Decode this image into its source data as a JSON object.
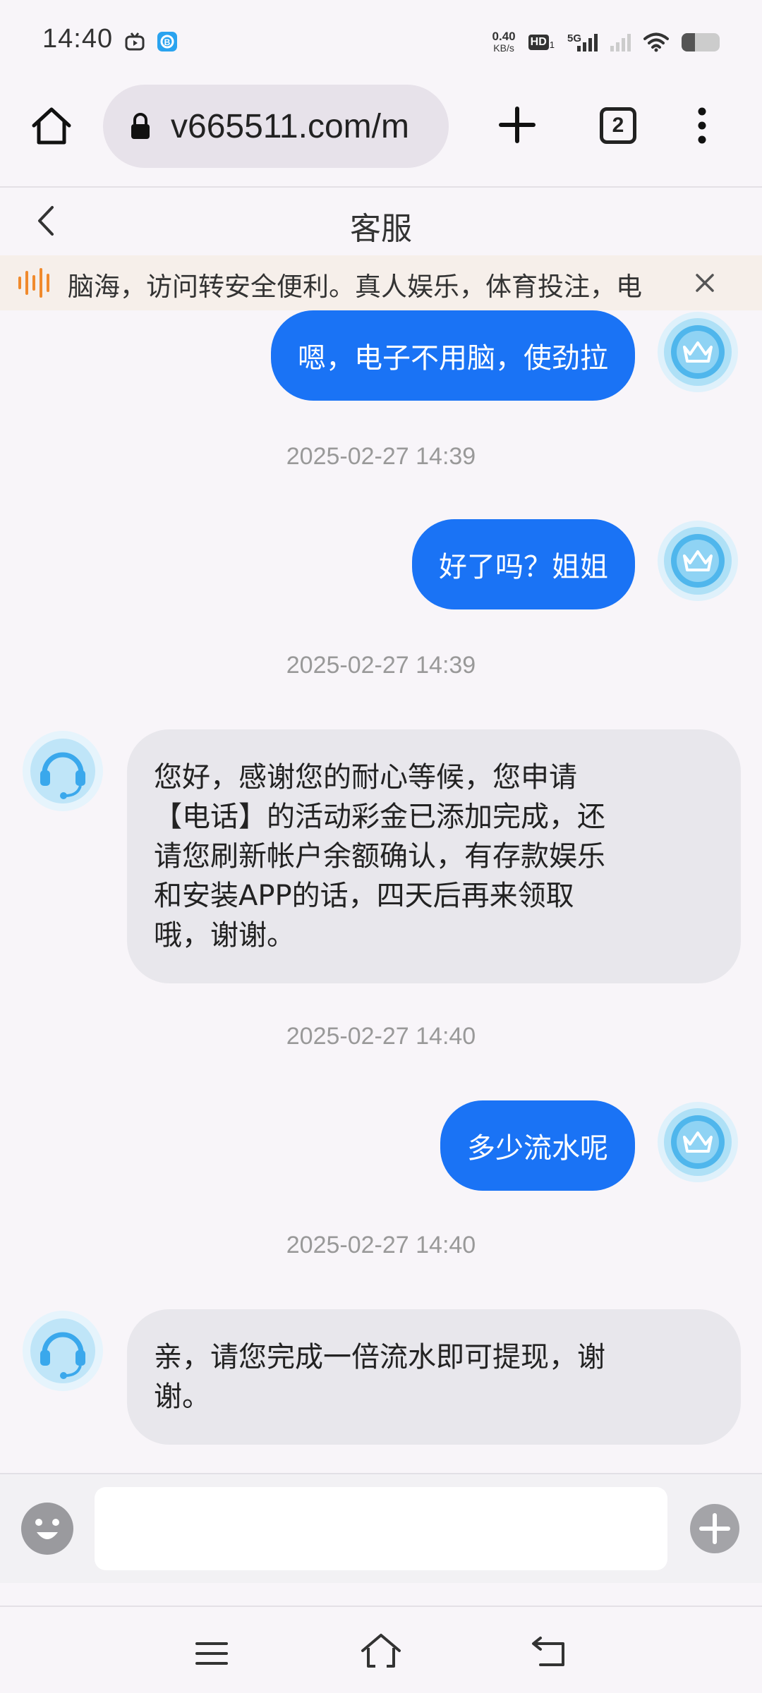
{
  "status_bar": {
    "time": "14:40",
    "net_speed_value": "0.40",
    "net_speed_unit": "KB/s",
    "hd_label": "HD",
    "hd_sub": "1",
    "network_label": "5G",
    "battery_level": 0.35
  },
  "browser": {
    "url": "v665511.com/m",
    "tab_count": "2",
    "icons": [
      "home-icon",
      "lock-icon",
      "plus-icon",
      "tabs-icon",
      "more-vert-icon"
    ]
  },
  "chat_header": {
    "title": "客服"
  },
  "notice": {
    "text": "脑海，访问转安全便利。真人娱乐，体育投注，电",
    "colors": {
      "accent": "#f08a2c",
      "background": "#f6efea"
    }
  },
  "messages": [
    {
      "type": "out",
      "text": "嗯，电子不用脑，使劲拉"
    },
    {
      "type": "time",
      "text": "2025-02-27 14:39"
    },
    {
      "type": "out",
      "text": "好了吗？姐姐"
    },
    {
      "type": "time",
      "text": "2025-02-27 14:39"
    },
    {
      "type": "in",
      "lines": [
        "您好，感谢您的耐心等候，您申请",
        "【电话】的活动彩金已添加完成，还",
        "请您刷新帐户余额确认，有存款娱乐",
        "和安装APP的话，四天后再来领取",
        "哦，谢谢。"
      ]
    },
    {
      "type": "time",
      "text": "2025-02-27 14:40"
    },
    {
      "type": "out",
      "text": "多少流水呢"
    },
    {
      "type": "time",
      "text": "2025-02-27 14:40"
    },
    {
      "type": "in",
      "lines": [
        "亲，请您完成一倍流水即可提现，谢",
        "谢。"
      ]
    }
  ],
  "input": {
    "value": "",
    "placeholder": ""
  },
  "colors": {
    "outgoing_bubble": "#1a73f5",
    "incoming_bubble": "#e8e7ec",
    "timestamp": "#999999"
  }
}
